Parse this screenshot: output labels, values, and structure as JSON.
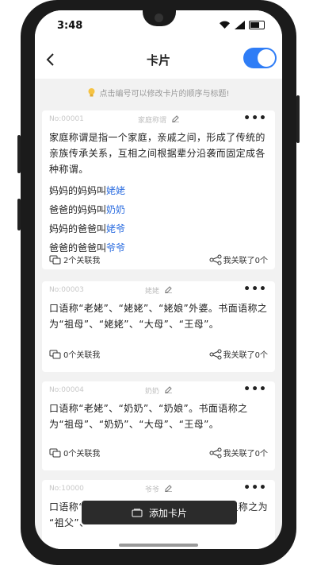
{
  "status": {
    "time": "3:48"
  },
  "header": {
    "title": "卡片"
  },
  "tip": "点击编号可以修改卡片的顺序与标题!",
  "cards": [
    {
      "number": "No:00001",
      "title": "家庭称谓",
      "text": "家庭称谓是指一个家庭，亲戚之间，形成了传统的亲族传承关系，互相之间根据辈分沿袭而固定成各种称谓。",
      "relations": [
        {
          "prefix": "妈妈的妈妈叫",
          "link": "姥姥"
        },
        {
          "prefix": "爸爸的妈妈叫",
          "link": "奶奶"
        },
        {
          "prefix": "妈妈的爸爸叫",
          "link": "姥爷"
        },
        {
          "prefix": "爸爸的爸爸叫",
          "link": "爷爷"
        }
      ],
      "linked_me": "2个关联我",
      "i_linked": "我关联了0个"
    },
    {
      "number": "No:00003",
      "title": "姥姥",
      "text": "口语称“老姥”、“姥姥”、“姥娘”外婆。书面语称之为“祖母”、“姥姥”、“大母”、“王母”。",
      "linked_me": "0个关联我",
      "i_linked": "我关联了0个"
    },
    {
      "number": "No:00004",
      "title": "奶奶",
      "text": "口语称“老姥”、“奶奶”、“奶娘”。书面语称之为“祖母”、“奶奶”、“大母”、“王母”。",
      "linked_me": "0个关联我",
      "i_linked": "我关联了0个"
    },
    {
      "number": "No:10000",
      "title": "爷爷",
      "text_left": "口语称“",
      "text_right": "祖称之为",
      "text_line2": "“祖父”、“"
    }
  ],
  "add_button": "添加卡片"
}
